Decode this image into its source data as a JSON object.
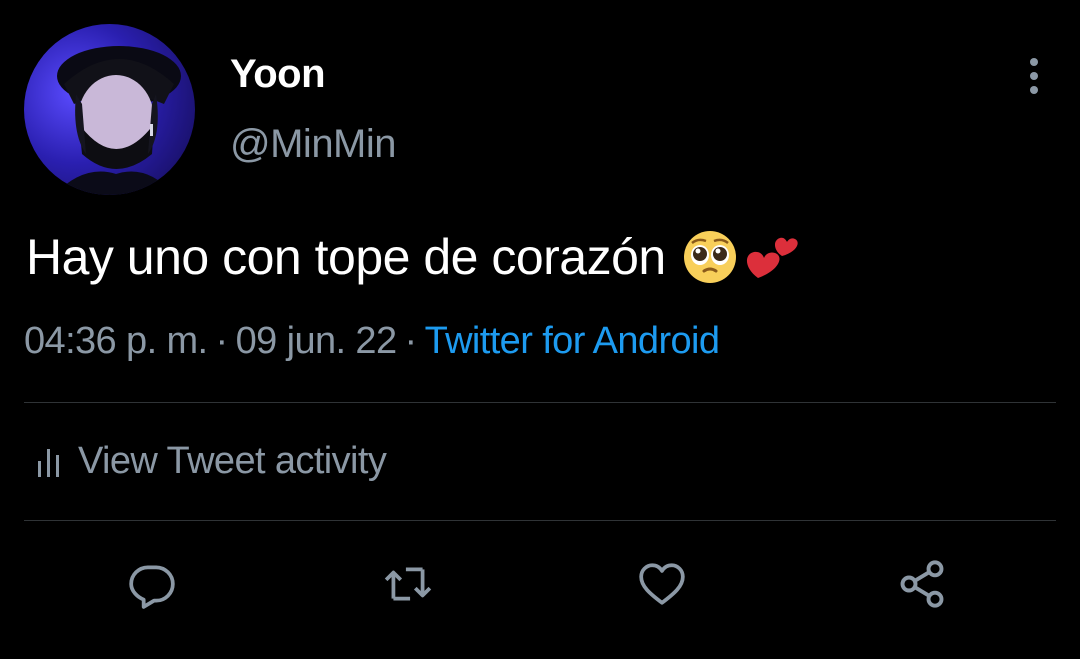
{
  "author": {
    "display_name": "Yoon",
    "handle": "@MinMin",
    "avatar_icon": "avatar-photo"
  },
  "tweet": {
    "text": "Hay uno con tope de corazón",
    "emojis": [
      "pleading-face",
      "two-hearts"
    ],
    "time": "04:36 p. m.",
    "date": "09 jun. 22",
    "separator": "·",
    "source": "Twitter for Android"
  },
  "activity": {
    "label": "View Tweet activity",
    "icon": "bar-chart-icon"
  },
  "actions": [
    {
      "name": "reply",
      "icon": "reply-icon"
    },
    {
      "name": "retweet",
      "icon": "retweet-icon"
    },
    {
      "name": "like",
      "icon": "heart-icon"
    },
    {
      "name": "share",
      "icon": "share-icon"
    }
  ],
  "colors": {
    "background": "#000000",
    "primary_text": "#ffffff",
    "secondary_text": "#8b98a5",
    "link": "#1d9bf0",
    "divider": "#2f3336"
  }
}
